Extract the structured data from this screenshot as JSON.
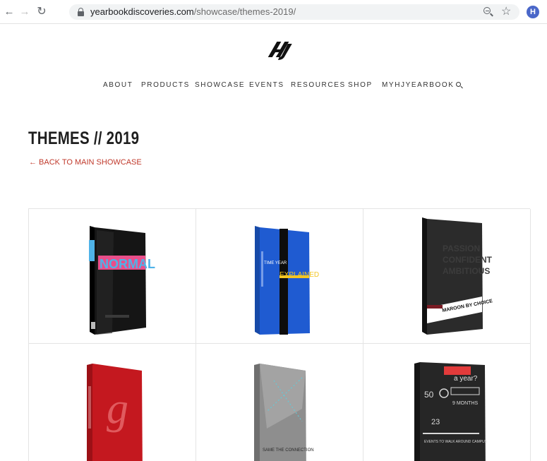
{
  "browser": {
    "url_domain": "yearbookdiscoveries.com",
    "url_path": "/showcase/themes-2019/",
    "profile_initial": "H"
  },
  "site": {
    "logo_text": "HJ",
    "nav": [
      "ABOUT",
      "PRODUCTS",
      "SHOWCASE",
      "EVENTS",
      "RESOURCES",
      "SHOP",
      "MYHJYEARBOOK"
    ]
  },
  "page": {
    "title": "THEMES // 2019",
    "back_link": "← BACK TO MAIN SHOWCASE"
  },
  "books": [
    {
      "cover_text": "NORMAL",
      "color": "#111111",
      "accent": "#4fb3e8"
    },
    {
      "cover_text": "EXPLAINED",
      "cover_subtext": "TIME YEAR",
      "color": "#1f5bd1",
      "accent": "#f3c623"
    },
    {
      "cover_text": "MAROON BY CHOICE",
      "color": "#2b2b2b",
      "accent": "#ffffff"
    },
    {
      "cover_text": "g",
      "color": "#c4181f",
      "accent": "#e05a5e"
    },
    {
      "cover_text": "SAME THE CONNECTION",
      "color": "#8e8e8e",
      "accent": "#5ad0e0"
    },
    {
      "cover_text": "a year?",
      "color": "#262626",
      "accent": "#e23b3b"
    }
  ],
  "colors": {
    "link": "#c0392b",
    "grid_border": "#e4e4e4"
  }
}
